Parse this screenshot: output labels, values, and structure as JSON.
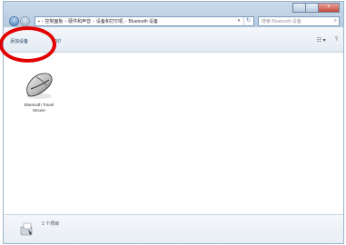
{
  "window": {
    "caption": {
      "minimize": "–",
      "maximize": "□",
      "close": "×"
    }
  },
  "address": {
    "crumbs": [
      "控制面板",
      "硬件和声音",
      "设备和打印机",
      "Bluetooth 设备"
    ],
    "root_icon": "computer-icon",
    "separator": "›"
  },
  "search": {
    "placeholder": "搜索 Bluetooth 设备"
  },
  "toolbar": {
    "add_device": "添加设备",
    "print": "打印",
    "view_options": "☷ ▾",
    "help": "?"
  },
  "devices": [
    {
      "label": "Bluetooth Travel Mouse",
      "icon": "mouse-icon"
    }
  ],
  "details": {
    "count": "1 个项目",
    "icon": "bluetooth-device-icon"
  },
  "colors": {
    "highlight": "#e10000",
    "titlebar": "#c9daea"
  }
}
